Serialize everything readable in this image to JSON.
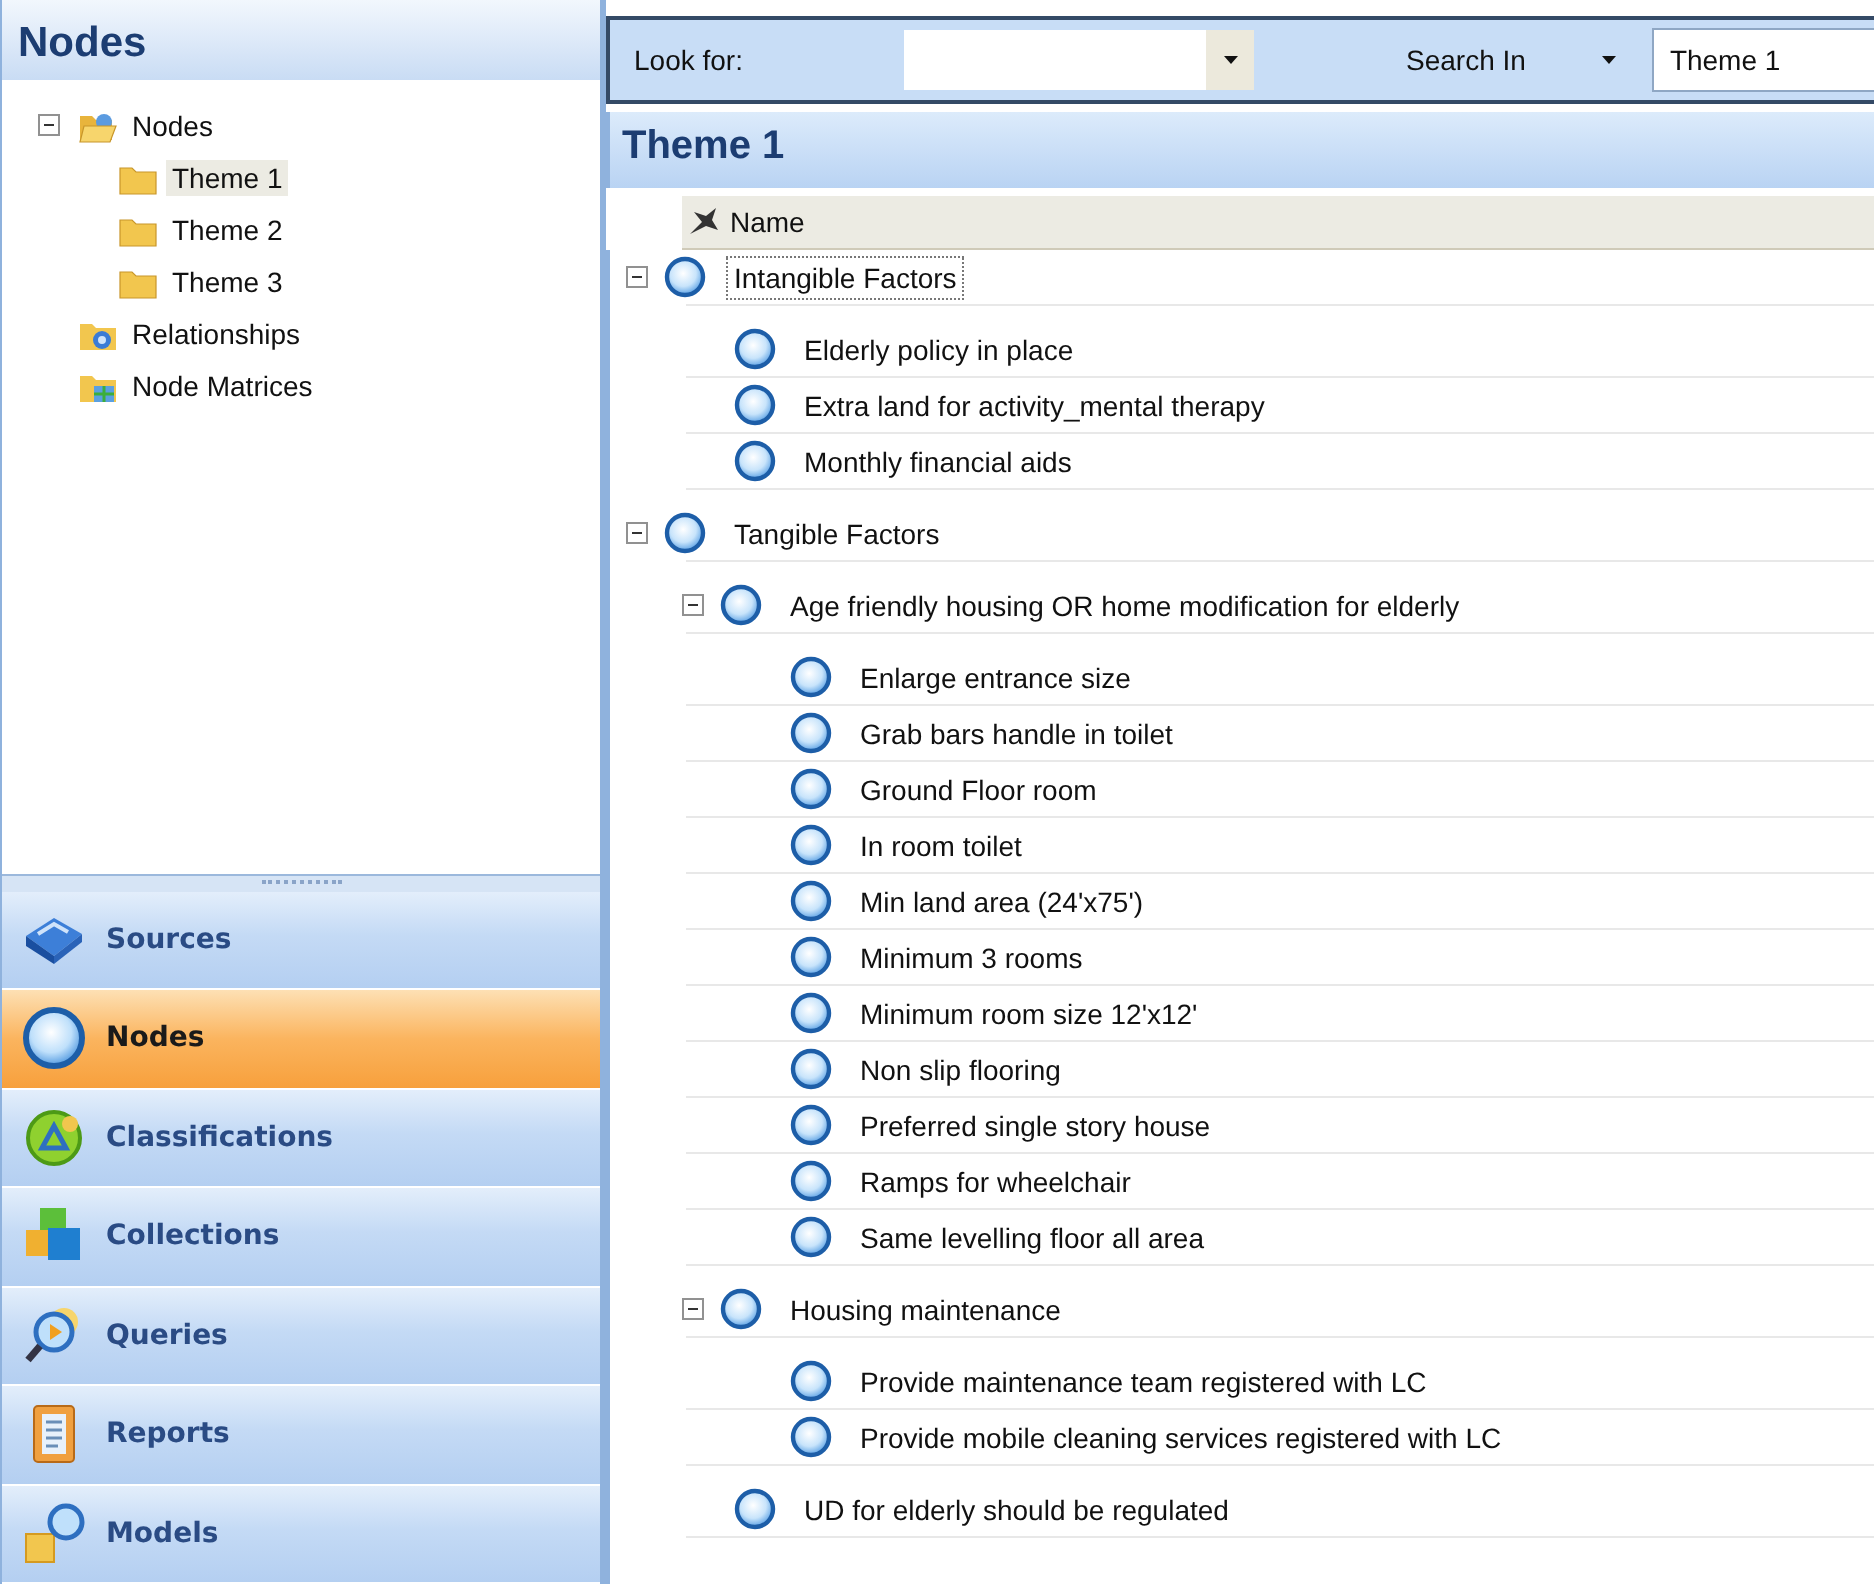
{
  "sidebar": {
    "title": "Nodes",
    "tree": [
      {
        "label": "Nodes",
        "kind": "root",
        "selected": false,
        "expanded": true,
        "children": [
          {
            "label": "Theme 1",
            "kind": "folder",
            "selected": true
          },
          {
            "label": "Theme 2",
            "kind": "folder",
            "selected": false
          },
          {
            "label": "Theme 3",
            "kind": "folder",
            "selected": false
          }
        ]
      },
      {
        "label": "Relationships",
        "kind": "relationships",
        "selected": false
      },
      {
        "label": "Node Matrices",
        "kind": "matrices",
        "selected": false
      }
    ],
    "nav": [
      {
        "label": "Sources",
        "kind": "sources",
        "selected": false
      },
      {
        "label": "Nodes",
        "kind": "nodes",
        "selected": true
      },
      {
        "label": "Classifications",
        "kind": "classifications",
        "selected": false
      },
      {
        "label": "Collections",
        "kind": "collections",
        "selected": false
      },
      {
        "label": "Queries",
        "kind": "queries",
        "selected": false
      },
      {
        "label": "Reports",
        "kind": "reports",
        "selected": false
      },
      {
        "label": "Models",
        "kind": "models",
        "selected": false
      }
    ]
  },
  "find_bar": {
    "look_for_label": "Look for:",
    "search_in_label": "Search In",
    "search_in_value": "Theme 1"
  },
  "content": {
    "title": "Theme 1",
    "column": "Name",
    "rows": [
      {
        "label": "Intangible Factors",
        "selected": true,
        "expanded": true,
        "children": [
          {
            "label": "Elderly policy in place",
            "selected": false
          },
          {
            "label": "Extra land for activity_mental therapy",
            "selected": false
          },
          {
            "label": "Monthly financial aids",
            "selected": false
          }
        ]
      },
      {
        "label": "Tangible Factors",
        "selected": false,
        "expanded": true,
        "children": [
          {
            "label": "Age friendly housing OR home modification for elderly",
            "selected": false,
            "expanded": true,
            "children": [
              {
                "label": "Enlarge entrance size",
                "selected": false
              },
              {
                "label": "Grab bars handle in toilet",
                "selected": false
              },
              {
                "label": "Ground Floor room",
                "selected": false
              },
              {
                "label": "In room toilet",
                "selected": false
              },
              {
                "label": "Min land area (24'x75')",
                "selected": false
              },
              {
                "label": "Minimum 3 rooms",
                "selected": false
              },
              {
                "label": "Minimum room size 12'x12'",
                "selected": false
              },
              {
                "label": "Non slip flooring",
                "selected": false
              },
              {
                "label": "Preferred single story house",
                "selected": false
              },
              {
                "label": "Ramps for wheelchair",
                "selected": false
              },
              {
                "label": "Same levelling floor all area",
                "selected": false
              }
            ]
          },
          {
            "label": "Housing maintenance",
            "selected": false,
            "expanded": true,
            "children": [
              {
                "label": "Provide maintenance team registered with LC",
                "selected": false
              },
              {
                "label": "Provide mobile cleaning services registered with LC",
                "selected": false
              }
            ]
          },
          {
            "label": "UD for elderly should be regulated",
            "selected": false
          }
        ]
      }
    ]
  }
}
